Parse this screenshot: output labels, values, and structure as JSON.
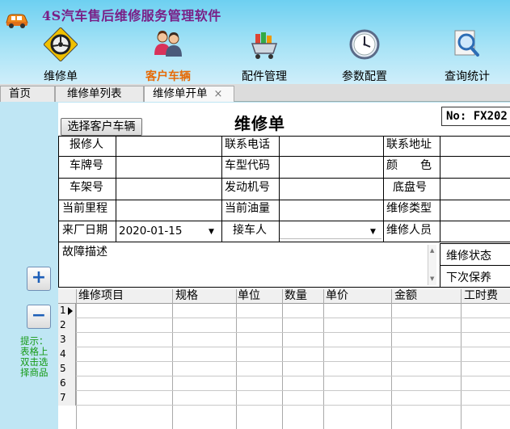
{
  "app": {
    "title": "4S汽车售后维修服务管理软件"
  },
  "nav": [
    {
      "label": "维修单",
      "icon": "steering-wheel-icon",
      "active": false
    },
    {
      "label": "客户车辆",
      "icon": "customers-icon",
      "active": true
    },
    {
      "label": "配件管理",
      "icon": "parts-cart-icon",
      "active": false
    },
    {
      "label": "参数配置",
      "icon": "clock-icon",
      "active": false
    },
    {
      "label": "查询统计",
      "icon": "magnifier-icon",
      "active": false
    }
  ],
  "tabs": [
    {
      "label": "首页"
    },
    {
      "label": "维修单列表"
    },
    {
      "label": "维修单开单",
      "closable": true,
      "close": "×"
    }
  ],
  "form": {
    "title": "维修单",
    "order_no": "No: FX202",
    "select_customer_button": "选择客户车辆",
    "labels": {
      "reporter": "报修人",
      "phone": "联系电话",
      "address": "联系地址",
      "plate": "车牌号",
      "model_code": "车型代码",
      "color": "颜　　色",
      "frame_no": "车架号",
      "engine_no": "发动机号",
      "chassis_no": "底盘号",
      "mileage": "当前里程",
      "fuel": "当前油量",
      "repair_type": "维修类型",
      "arrival_date": "来厂日期",
      "receiver": "接车人",
      "repairman": "维修人员",
      "fault": "故障描述",
      "repair_status": "维修状态",
      "next_maintenance": "下次保养"
    },
    "values": {
      "arrival_date": "2020-01-15",
      "receiver": ""
    }
  },
  "grid": {
    "columns": [
      "维修项目",
      "规格",
      "单位",
      "数量",
      "单价",
      "金额",
      "工时费"
    ],
    "rows": [
      "1",
      "2",
      "3",
      "4",
      "5",
      "6",
      "7"
    ]
  },
  "side": {
    "add_label": "+",
    "remove_label": "−",
    "hint": "提示：表格上双击选择商品"
  },
  "colors": {
    "title_purple": "#7a1f86",
    "active_nav_orange": "#e66b06",
    "hint_green": "#169a16",
    "header_blue": "#6dd0f1"
  }
}
